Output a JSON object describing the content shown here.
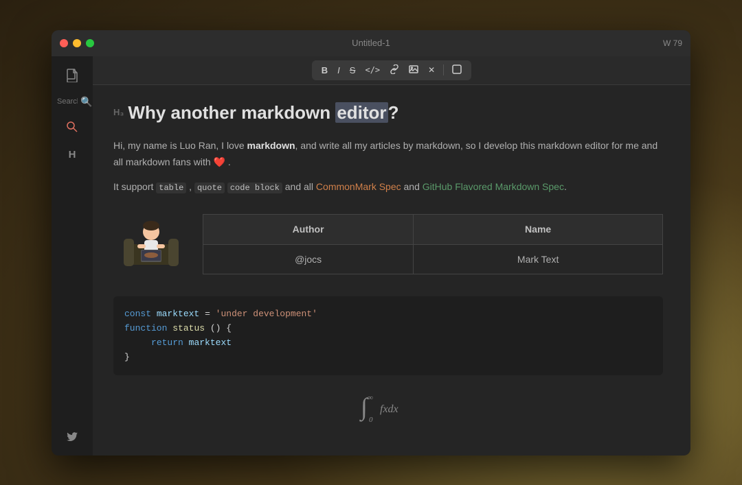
{
  "window": {
    "title": "Untitled-1",
    "word_count": "W 79"
  },
  "sidebar": {
    "search_placeholder": "Search in folder...",
    "icons": [
      {
        "name": "file-icon",
        "symbol": "🗋",
        "active": false
      },
      {
        "name": "search-icon",
        "symbol": "⌕",
        "active": true
      },
      {
        "name": "heading-icon",
        "symbol": "H",
        "active": false
      }
    ],
    "bottom_icon": {
      "name": "twitter-icon",
      "symbol": "🐦"
    }
  },
  "toolbar": {
    "buttons": [
      {
        "name": "bold-button",
        "label": "B"
      },
      {
        "name": "italic-button",
        "label": "I"
      },
      {
        "name": "strikethrough-button",
        "label": "S̶"
      },
      {
        "name": "code-button",
        "label": "</>"
      },
      {
        "name": "link-button",
        "label": "🔗"
      },
      {
        "name": "image-button",
        "label": "⊡"
      },
      {
        "name": "clear-button",
        "label": "✕"
      },
      {
        "name": "erase-button",
        "label": "◻"
      }
    ]
  },
  "editor": {
    "heading_indicator": "H₃",
    "heading": "Why another markdown editor?",
    "heading_selected_word": "editor",
    "para1_prefix": "Hi, my name is Luo Ran, I love ",
    "para1_bold": "markdown",
    "para1_suffix": ", and write all my articles by markdown, so I develop this markdown editor for me and all markdown fans with",
    "para1_heart": "❤️",
    "para2_prefix": "It support ",
    "para2_code1": "table",
    "para2_code2": "quote",
    "para2_code3": "code block",
    "para2_middle": " and all ",
    "para2_link1": "CommonMark Spec",
    "para2_and": " and ",
    "para2_link2": "GitHub Flavored Markdown Spec",
    "para2_end": ".",
    "table": {
      "headers": [
        "Author",
        "Name"
      ],
      "rows": [
        [
          "@jocs",
          "Mark Text"
        ]
      ]
    },
    "code": {
      "line1_kw": "const",
      "line1_var": "marktext",
      "line1_eq": " = ",
      "line1_str": "'under development'",
      "line2_kw": "function",
      "line2_fn": "status",
      "line2_suffix": " () {",
      "line3_indent": "    ",
      "line3_kw": "return",
      "line3_var": "marktext",
      "line4": "}"
    },
    "math": "∫₀^∞ fxdx"
  }
}
